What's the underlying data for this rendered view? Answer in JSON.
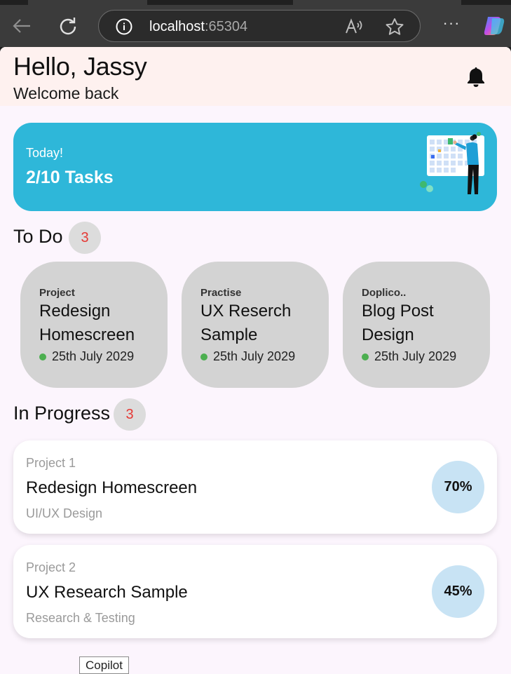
{
  "browser": {
    "host": "localhost",
    "port": ":65304",
    "more_label": "···"
  },
  "header": {
    "greeting": "Hello, Jassy",
    "subtitle": "Welcome back"
  },
  "summary": {
    "label": "Today!",
    "tasks": "2/10 Tasks"
  },
  "todo": {
    "title": "To Do",
    "count": "3",
    "cards": [
      {
        "category": "Project",
        "title": "Redesign Homescreen",
        "date": "25th July 2029"
      },
      {
        "category": "Practise",
        "title": "UX Reserch Sample",
        "date": "25th July 2029"
      },
      {
        "category": "Doplico..",
        "title": "Blog Post Design",
        "date": "25th July 2029"
      }
    ]
  },
  "in_progress": {
    "title": "In Progress",
    "count": "3",
    "cards": [
      {
        "label": "Project 1",
        "title": "Redesign Homescreen",
        "subtitle": "UI/UX Design",
        "progress": "70%"
      },
      {
        "label": "Project 2",
        "title": "UX Research Sample",
        "subtitle": "Research & Testing",
        "progress": "45%"
      }
    ]
  },
  "tooltip": "Copilot",
  "colors": {
    "accent": "#2eb7d9",
    "badge_text": "#e53935",
    "status_dot": "#4caf50",
    "progress_circle": "#c8e3f4"
  }
}
